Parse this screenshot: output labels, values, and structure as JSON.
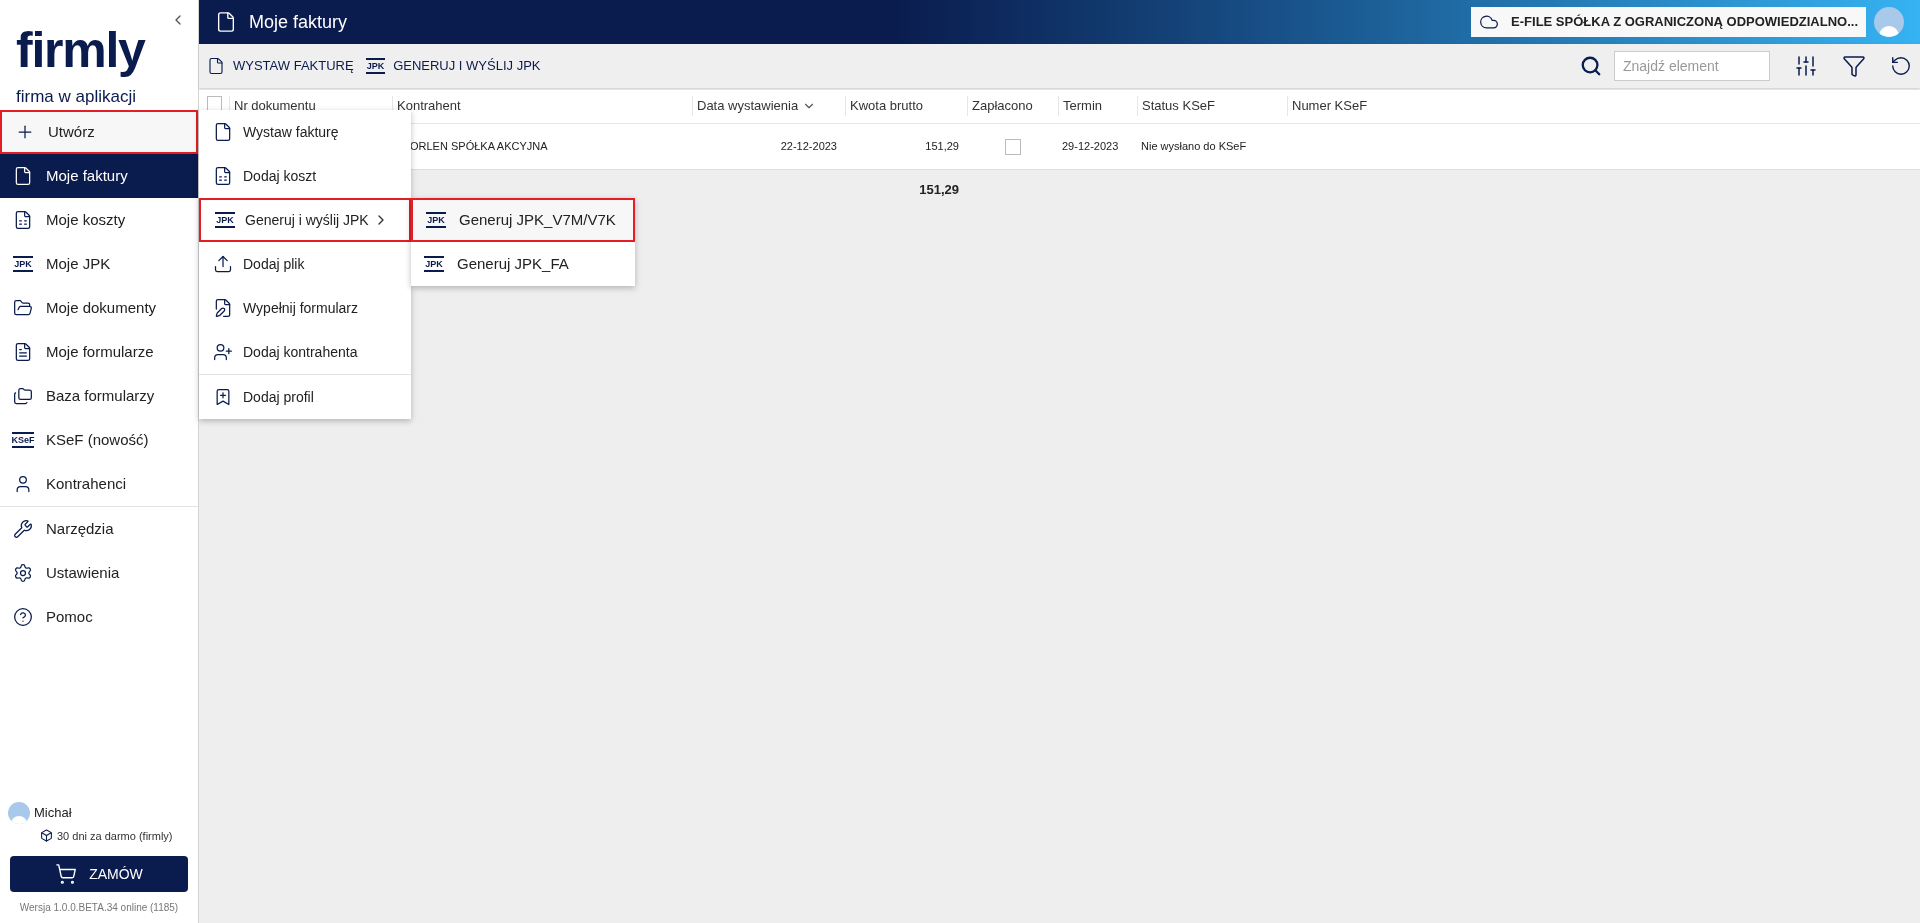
{
  "logo": {
    "name": "firmly",
    "tagline": "firma w aplikacji"
  },
  "sidebar": {
    "items": [
      {
        "label": "Utwórz",
        "kind": "plus",
        "selected": false,
        "highlighted": true
      },
      {
        "label": "Moje faktury",
        "kind": "invoice",
        "selected": true,
        "highlighted": false
      },
      {
        "label": "Moje koszty",
        "kind": "cost",
        "selected": false,
        "highlighted": false
      },
      {
        "label": "Moje JPK",
        "kind": "badge",
        "icon_text": "JPK",
        "selected": false,
        "highlighted": false
      },
      {
        "label": "Moje dokumenty",
        "kind": "folder",
        "selected": false,
        "highlighted": false
      },
      {
        "label": "Moje formularze",
        "kind": "form",
        "selected": false,
        "highlighted": false
      },
      {
        "label": "Baza formularzy",
        "kind": "folders",
        "selected": false,
        "highlighted": false
      },
      {
        "label": "KSeF (nowość)",
        "kind": "badge",
        "icon_text": "KSeF",
        "selected": false,
        "highlighted": false
      },
      {
        "label": "Kontrahenci",
        "kind": "person",
        "selected": false,
        "highlighted": false
      },
      {
        "label": "Narzędzia",
        "kind": "tools",
        "selected": false,
        "highlighted": false
      },
      {
        "label": "Ustawienia",
        "kind": "gear",
        "selected": false,
        "highlighted": false
      },
      {
        "label": "Pomoc",
        "kind": "help",
        "selected": false,
        "highlighted": false
      }
    ],
    "user": "Michał",
    "plan": "30 dni za darmo (firmly)",
    "order_button": "ZAMÓW",
    "version": "Wersja 1.0.0.BETA.34 online (1185)"
  },
  "create_menu": [
    {
      "label": "Wystaw fakturę",
      "kind": "invoice",
      "highlighted": false,
      "submenu": false
    },
    {
      "label": "Dodaj koszt",
      "kind": "cost",
      "highlighted": false,
      "submenu": false
    },
    {
      "label": "Generuj i wyślij JPK",
      "kind": "badge",
      "icon_text": "JPK",
      "highlighted": true,
      "submenu": true
    },
    {
      "label": "Dodaj plik",
      "kind": "upload",
      "highlighted": false,
      "submenu": false
    },
    {
      "label": "Wypełnij formularz",
      "kind": "fill",
      "highlighted": false,
      "submenu": false
    },
    {
      "label": "Dodaj kontrahenta",
      "kind": "person-add",
      "highlighted": false,
      "submenu": false
    },
    {
      "label": "Dodaj profil",
      "kind": "profile",
      "highlighted": false,
      "submenu": false
    }
  ],
  "jpk_submenu": [
    {
      "label": "Generuj JPK_V7M/V7K",
      "icon_text": "JPK",
      "highlighted": true
    },
    {
      "label": "Generuj JPK_FA",
      "icon_text": "JPK",
      "highlighted": false
    }
  ],
  "header": {
    "title": "Moje faktury",
    "company": "E-FILE SPÓŁKA Z OGRANICZONĄ ODPOWIEDZIALNO..."
  },
  "toolbar": {
    "actions": [
      {
        "label": "WYSTAW FAKTURĘ",
        "kind": "invoice"
      },
      {
        "label": "GENERUJ I WYŚLIJ JPK",
        "kind": "badge",
        "icon_text": "JPK"
      }
    ],
    "search_placeholder": "Znajdź element"
  },
  "table": {
    "all_checked": false,
    "columns": [
      {
        "label": "Nr dokumentu",
        "sorted": false
      },
      {
        "label": "Kontrahent",
        "sorted": false
      },
      {
        "label": "Data wystawienia",
        "sorted": true
      },
      {
        "label": "Kwota brutto",
        "sorted": false
      },
      {
        "label": "Zapłacono",
        "sorted": false
      },
      {
        "label": "Termin",
        "sorted": false
      },
      {
        "label": "Status KSeF",
        "sorted": false
      },
      {
        "label": "Numer KSeF",
        "sorted": false
      }
    ],
    "rows": [
      {
        "contractor": "ORLEN SPÓŁKA AKCYJNA",
        "date": "22-12-2023",
        "amount": "151,29",
        "paid": false,
        "due": "29-12-2023",
        "ksef_status": "Nie wysłano do KSeF"
      }
    ],
    "total": "151,29"
  }
}
